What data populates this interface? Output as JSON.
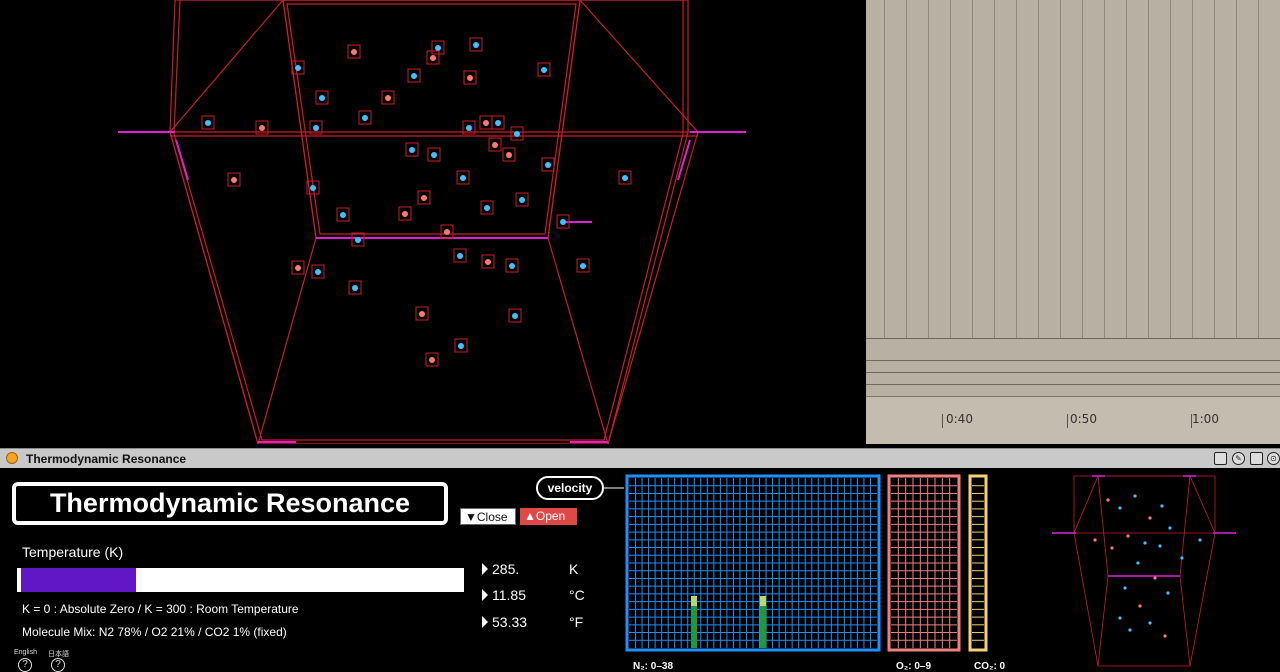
{
  "timeline": {
    "ticks": [
      "0:40",
      "0:50",
      "1:00"
    ]
  },
  "device": {
    "window_title": "Thermodynamic Resonance",
    "title": "Thermodynamic Resonance",
    "close_label": "▼Close",
    "open_label": "▲Open",
    "velocity_label": "velocity",
    "temperature_label": "Temperature (K)",
    "temperature_value": 285,
    "temperature_max": 600,
    "kelvin": "285.",
    "kelvin_unit": "K",
    "celsius": "11.85",
    "celsius_unit": "°C",
    "fahrenheit": "53.33",
    "fahrenheit_unit": "°F",
    "description": "K = 0 : Absolute Zero  /  K = 300 : Room Temperature",
    "mix": "Molecule Mix: N2 78%  /  O2 21%  /  CO2 1%  (fixed)",
    "lang_en": "English",
    "lang_ja": "日本語",
    "help_glyph": "?",
    "n2_label": "N₂: 0–38",
    "o2_label": "O₂: 0–9",
    "co2_label": "CO₂: 0",
    "colors": {
      "accent_purple": "#6217c6",
      "open_red": "#e04848",
      "n2_blue": "#1e90ff",
      "o2_salmon": "#f07f7f",
      "co2_yellow": "#f5cf7a",
      "wire_red": "#d0202a",
      "wire_magenta": "#e020d0"
    }
  }
}
